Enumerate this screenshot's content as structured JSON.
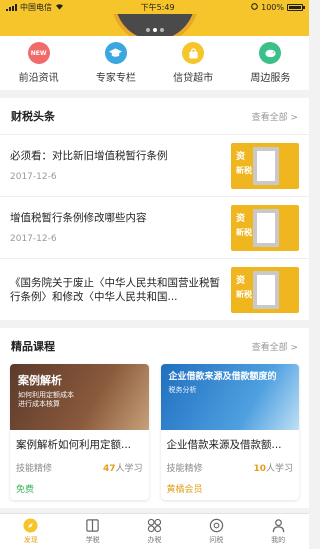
{
  "status_bar": {
    "carrier": "中国电信",
    "time": "下午5:49",
    "battery": "100%"
  },
  "quick_links": [
    {
      "label": "前沿资讯",
      "badge": "NEW",
      "color": "#f26b6b"
    },
    {
      "label": "专家专栏",
      "color": "#3aa7e0"
    },
    {
      "label": "信贷超市",
      "color": "#f5c52b"
    },
    {
      "label": "周边服务",
      "color": "#3cc08a"
    }
  ],
  "news_section": {
    "title": "财税头条",
    "see_all": "查看全部 >",
    "items": [
      {
        "title": "必须看：对比新旧增值税暂行条例",
        "date": "2017-12-6"
      },
      {
        "title": "增值税暂行条例修改哪些内容",
        "date": "2017-12-6"
      },
      {
        "title": "《国务院关于废止〈中华人民共和国营业税暂行条例〉和修改〈中华人民共和国...",
        "date": ""
      }
    ],
    "thumb_text_1": "资",
    "thumb_text_2": "新税"
  },
  "course_section": {
    "title": "精品课程",
    "see_all": "查看全部 >",
    "courses": [
      {
        "img_title": "案例解析",
        "img_sub": "如何利用定额成本\n进行成本核算",
        "name": "案例解析如何利用定额...",
        "category": "技能精修",
        "learners_count": "47",
        "learners_suffix": "人学习",
        "price": "免费"
      },
      {
        "img_title": "企业借款来源及借款额度的",
        "img_sub": "税务分析",
        "name": "企业借款来源及借款额...",
        "category": "技能精修",
        "learners_count": "10",
        "learners_suffix": "人学习",
        "price": "黄橘会员"
      }
    ]
  },
  "tabbar": [
    {
      "label": "发现",
      "icon": "compass-icon",
      "active": true
    },
    {
      "label": "学税",
      "icon": "book-icon"
    },
    {
      "label": "办税",
      "icon": "grid-icon"
    },
    {
      "label": "问税",
      "icon": "question-icon"
    },
    {
      "label": "我的",
      "icon": "person-icon"
    }
  ],
  "colors": {
    "brand_yellow": "#f5c52b",
    "accent_orange": "#e3a01c",
    "free_green": "#3cb35a"
  }
}
